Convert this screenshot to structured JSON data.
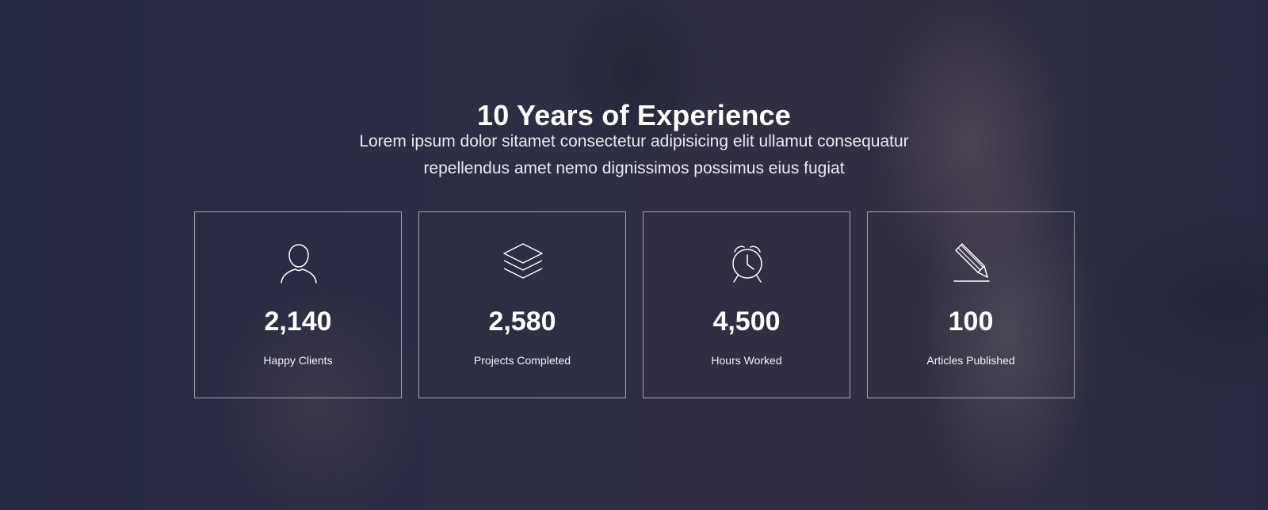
{
  "hero": {
    "title": "10 Years of Experience",
    "subtitle_lines": [
      "Lorem ipsum dolor sitamet consectetur adipisicing elit ullamut consequatur",
      "repellendus amet nemo dignissimos possimus eius fugiat"
    ]
  },
  "stats": [
    {
      "icon": "user-icon",
      "value": "2,140",
      "label": "Happy Clients"
    },
    {
      "icon": "layers-icon",
      "value": "2,580",
      "label": "Projects Completed"
    },
    {
      "icon": "alarm-clock-icon",
      "value": "4,500",
      "label": "Hours Worked"
    },
    {
      "icon": "pencil-icon",
      "value": "100",
      "label": "Articles Published"
    }
  ]
}
